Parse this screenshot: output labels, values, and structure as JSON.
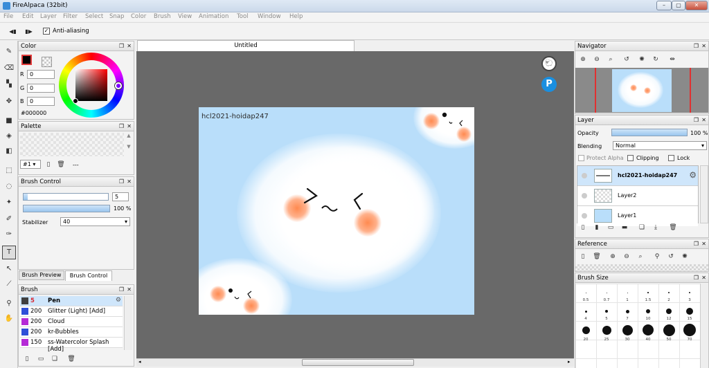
{
  "window": {
    "title": "FireAlpaca (32bit)"
  },
  "menu": [
    "File",
    "Edit",
    "Layer",
    "Filter",
    "Select",
    "Snap",
    "Color",
    "Brush",
    "View",
    "Animation",
    "Tool",
    "Window",
    "Help"
  ],
  "toolbar": {
    "antialias_label": "Anti-aliasing"
  },
  "color_panel": {
    "title": "Color",
    "r_label": "R",
    "g_label": "G",
    "b_label": "B",
    "r": "0",
    "g": "0",
    "b": "0",
    "hex": "#000000"
  },
  "palette_panel": {
    "title": "Palette",
    "selected": "#1",
    "dash": "---"
  },
  "brush_control": {
    "title": "Brush Control",
    "size": "5",
    "opacity": "100 %",
    "opacity_value": 100,
    "size_fraction": 0.05,
    "stabilizer_label": "Stabilizer",
    "stabilizer_value": "40"
  },
  "tabs": {
    "preview": "Brush Preview",
    "control": "Brush Control"
  },
  "brush_panel": {
    "title": "Brush",
    "items": [
      {
        "size": "5",
        "name": "Pen",
        "color": "#3f3f3f"
      },
      {
        "size": "200",
        "name": "Glitter (Light) [Add]",
        "color": "#2e4fd8"
      },
      {
        "size": "200",
        "name": "Cloud",
        "color": "#b52ad6"
      },
      {
        "size": "200",
        "name": "kr-Bubbles",
        "color": "#2e4fd8"
      },
      {
        "size": "150",
        "name": "ss-Watercolor Splash [Add]",
        "color": "#b52ad6"
      }
    ]
  },
  "document": {
    "tab": "Untitled",
    "canvas_text": "hcl2021-hoidap247"
  },
  "navigator": {
    "title": "Navigator"
  },
  "layer_panel": {
    "title": "Layer",
    "opacity_label": "Opacity",
    "opacity": "100 %",
    "opacity_value": 100,
    "blending_label": "Blending",
    "blending": "Normal",
    "protect_alpha": "Protect Alpha",
    "clipping": "Clipping",
    "lock": "Lock",
    "layers": [
      {
        "name": "hcl2021-hoidap247"
      },
      {
        "name": "Layer2"
      },
      {
        "name": "Layer1"
      }
    ]
  },
  "reference": {
    "title": "Reference"
  },
  "brush_size": {
    "title": "Brush Size",
    "sizes": [
      "0.5",
      "0.7",
      "1",
      "1.5",
      "2",
      "3",
      "4",
      "5",
      "7",
      "10",
      "12",
      "15",
      "20",
      "25",
      "30",
      "40",
      "50",
      "70"
    ]
  },
  "colors": {
    "accent": "#9ac6ee",
    "canvas_bg": "#b9defa",
    "workspace": "#696969"
  }
}
